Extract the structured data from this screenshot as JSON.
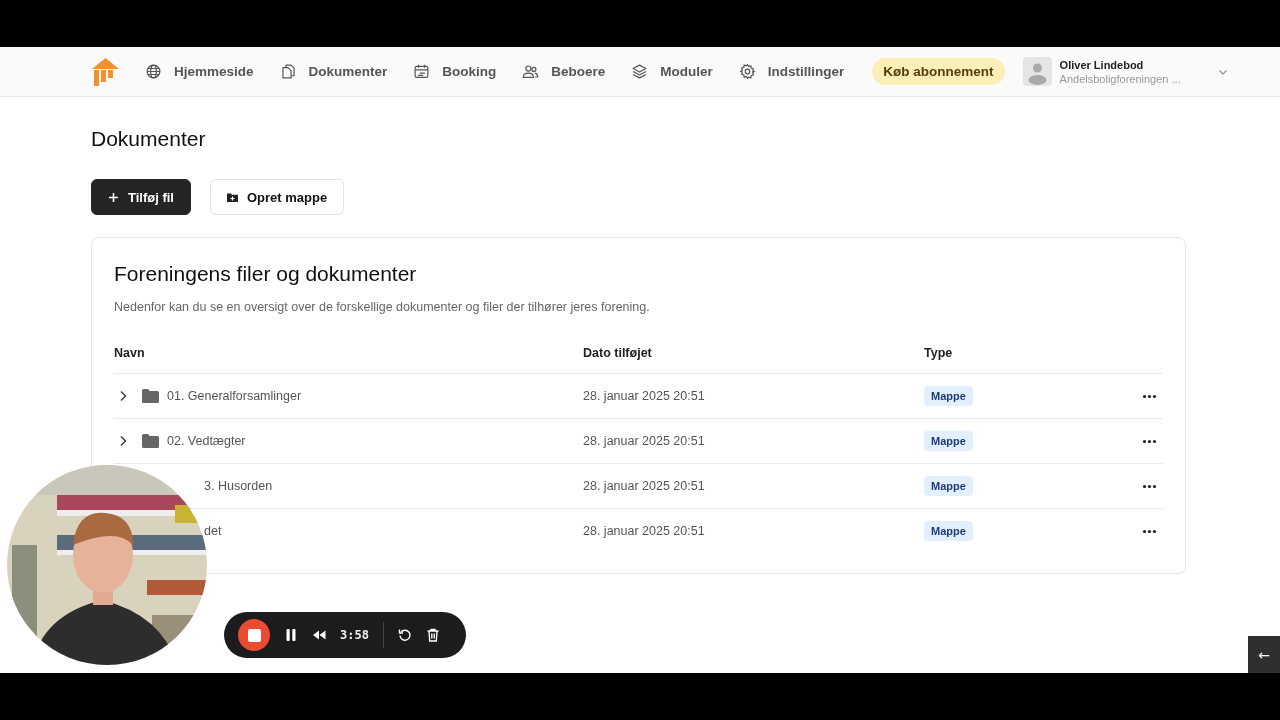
{
  "nav": {
    "items": [
      {
        "label": "Hjemmeside"
      },
      {
        "label": "Dokumenter"
      },
      {
        "label": "Booking"
      },
      {
        "label": "Beboere"
      },
      {
        "label": "Moduler"
      },
      {
        "label": "Indstillinger"
      }
    ],
    "cta": "Køb abonnement",
    "user": {
      "name": "Oliver Lindebod",
      "org": "Andelsboligforeningen ..."
    }
  },
  "page_title": "Dokumenter",
  "actions": [
    {
      "label": "Tilføj fil",
      "kind": "primary"
    },
    {
      "label": "Opret mappe",
      "kind": "secondary"
    }
  ],
  "card": {
    "title": "Foreningens filer og dokumenter",
    "description": "Nedenfor kan du se en oversigt over de forskellige dokumenter og filer der tilhører jeres forening.",
    "columns": [
      "Navn",
      "Dato tilføjet",
      "Type"
    ],
    "rows": [
      {
        "kind": "folder",
        "name": "01. Generalforsamlinger",
        "date": "28. januar 2025 20:51",
        "type": "Mappe"
      },
      {
        "kind": "folder",
        "name": "02. Vedtægter",
        "date": "28. januar 2025 20:51",
        "type": "Mappe"
      },
      {
        "kind": "covered",
        "name": "3. Husorden",
        "date": "28. januar 2025 20:51",
        "type": "Mappe"
      },
      {
        "kind": "covered",
        "name": "det",
        "date": "28. januar 2025 20:51",
        "type": "Mappe"
      }
    ]
  },
  "recorder": {
    "time": "3:58"
  },
  "corner_button": "←"
}
